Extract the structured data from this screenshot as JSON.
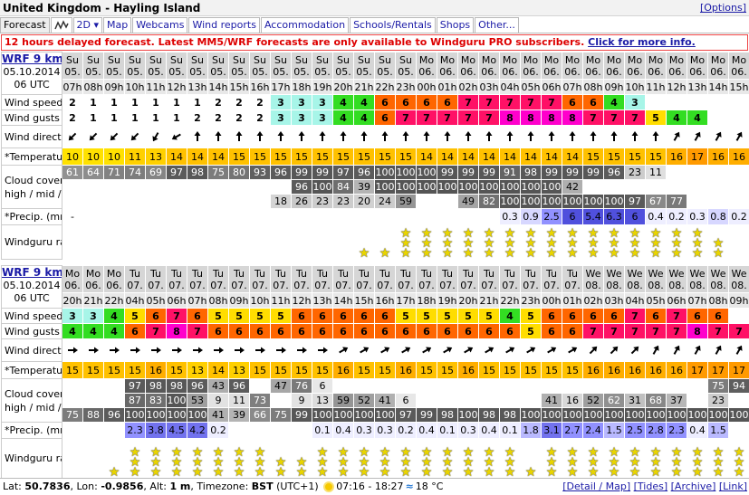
{
  "header": {
    "title": "United Kingdom - Hayling Island",
    "options": "[Options]"
  },
  "tabs": [
    {
      "label": "Forecast",
      "active": true
    },
    {
      "label": "",
      "icon": "chart-icon"
    },
    {
      "label": "2D ▾"
    },
    {
      "label": "Map"
    },
    {
      "label": "Webcams"
    },
    {
      "label": "Wind reports"
    },
    {
      "label": "Accommodation"
    },
    {
      "label": "Schools/Rentals"
    },
    {
      "label": "Shops"
    },
    {
      "label": "Other..."
    }
  ],
  "notice": {
    "text": "12 hours delayed forecast. Latest MM5/WRF forecasts are only available to Windguru PRO subscribers. ",
    "link": "Click for more info."
  },
  "labels": {
    "wind_speed": "Wind speed",
    "wind_gusts": "Wind gusts",
    "unit_bft": "(Bft)",
    "wind_direction": "Wind direction",
    "temperature": "*Temperature",
    "unit_c": "(°C)",
    "cloud1": "Cloud cover (%)",
    "cloud2": "high / mid / low",
    "precip": "*Precip. (mm/1h)",
    "rating": "Windguru rating"
  },
  "colors": {
    "day_header": "#d6d6d6",
    "hour_header": "#e8e8e8",
    "link": "#1a1aa6",
    "notice": "#dd0000"
  },
  "tables": [
    {
      "model": "WRF 9 km",
      "date": "05.10.2014",
      "run": "06 UTC",
      "days": [
        "Su",
        "Su",
        "Su",
        "Su",
        "Su",
        "Su",
        "Su",
        "Su",
        "Su",
        "Su",
        "Su",
        "Su",
        "Su",
        "Su",
        "Su",
        "Su",
        "Su",
        "Mo",
        "Mo",
        "Mo",
        "Mo",
        "Mo",
        "Mo",
        "Mo",
        "Mo",
        "Mo",
        "Mo",
        "Mo",
        "Mo",
        "Mo",
        "Mo",
        "Mo",
        "Mo"
      ],
      "dates": [
        "05.",
        "05.",
        "05.",
        "05.",
        "05.",
        "05.",
        "05.",
        "05.",
        "05.",
        "05.",
        "05.",
        "05.",
        "05.",
        "05.",
        "05.",
        "05.",
        "05.",
        "06.",
        "06.",
        "06.",
        "06.",
        "06.",
        "06.",
        "06.",
        "06.",
        "06.",
        "06.",
        "06.",
        "06.",
        "06.",
        "06.",
        "06.",
        "06."
      ],
      "hours": [
        "07h",
        "08h",
        "09h",
        "10h",
        "11h",
        "12h",
        "13h",
        "14h",
        "15h",
        "16h",
        "17h",
        "18h",
        "19h",
        "20h",
        "21h",
        "22h",
        "23h",
        "00h",
        "01h",
        "02h",
        "03h",
        "04h",
        "05h",
        "06h",
        "07h",
        "08h",
        "09h",
        "10h",
        "11h",
        "12h",
        "13h",
        "14h",
        "15h",
        "16h",
        "17h",
        "18h",
        "19h"
      ],
      "wind_speed": [
        2,
        1,
        1,
        1,
        1,
        1,
        1,
        2,
        2,
        2,
        3,
        3,
        3,
        4,
        4,
        6,
        6,
        6,
        6,
        7,
        7,
        7,
        7,
        7,
        6,
        6,
        4,
        3
      ],
      "wind_gusts": [
        2,
        1,
        1,
        1,
        1,
        1,
        2,
        2,
        2,
        2,
        3,
        3,
        3,
        4,
        4,
        6,
        7,
        7,
        7,
        7,
        7,
        8,
        8,
        8,
        8,
        7,
        7,
        7,
        5,
        4,
        4
      ],
      "direction": [
        225,
        225,
        225,
        225,
        210,
        240,
        0,
        0,
        0,
        0,
        0,
        0,
        0,
        0,
        0,
        0,
        0,
        0,
        0,
        0,
        0,
        0,
        0,
        0,
        0,
        0,
        0,
        0,
        0,
        30,
        30,
        30,
        30
      ],
      "temperature": [
        10,
        10,
        10,
        11,
        13,
        14,
        14,
        14,
        15,
        15,
        15,
        15,
        15,
        15,
        15,
        15,
        15,
        14,
        14,
        14,
        14,
        14,
        14,
        14,
        14,
        15,
        15,
        15,
        15,
        16,
        17,
        16,
        16
      ],
      "cloud_high": [
        61,
        64,
        71,
        74,
        69,
        97,
        98,
        75,
        80,
        93,
        96,
        99,
        99,
        97,
        96,
        100,
        100,
        100,
        99,
        99,
        99,
        91,
        98,
        99,
        99,
        99,
        96,
        23,
        11
      ],
      "cloud_mid": [
        "",
        "",
        "",
        "",
        "",
        "",
        "",
        "",
        "",
        "",
        "",
        "96",
        "100",
        "84",
        "39",
        "100",
        "100",
        "100",
        "100",
        "100",
        "100",
        "100",
        "100",
        "100",
        "42",
        "",
        "",
        "",
        ""
      ],
      "cloud_low": [
        "",
        "",
        "",
        "",
        "",
        "",
        "",
        "",
        "",
        "",
        "18",
        "26",
        "23",
        "23",
        "20",
        "24",
        "59",
        "",
        "",
        "49",
        "82",
        "100",
        "100",
        "100",
        "100",
        "100",
        "100",
        "97",
        "67",
        "77"
      ],
      "precip": [
        "-",
        "",
        "",
        "",
        "",
        "",
        "",
        "",
        "",
        "",
        "",
        "",
        "",
        "",
        "",
        "",
        "",
        "",
        "",
        "",
        "",
        "0.3",
        "0.9",
        "2.5",
        "6",
        "5.4",
        "6.3",
        "6",
        "0.4",
        "0.2",
        "0.3",
        "0.8",
        "0.2"
      ],
      "rating": [
        0,
        0,
        0,
        0,
        0,
        0,
        0,
        0,
        0,
        0,
        0,
        0,
        0,
        0,
        1,
        1,
        3,
        3,
        3,
        3,
        3,
        3,
        3,
        3,
        3,
        3,
        3,
        3,
        3,
        3,
        3,
        2,
        0
      ]
    },
    {
      "model": "WRF 9 km",
      "date": "05.10.2014",
      "run": "06 UTC",
      "days": [
        "Mo",
        "Mo",
        "Mo",
        "Tu",
        "Tu",
        "Tu",
        "Tu",
        "Tu",
        "Tu",
        "Tu",
        "Tu",
        "Tu",
        "Tu",
        "Tu",
        "Tu",
        "Tu",
        "Tu",
        "Tu",
        "Tu",
        "Tu",
        "Tu",
        "Tu",
        "Tu",
        "Tu",
        "Tu",
        "We",
        "We",
        "We",
        "We",
        "We",
        "We",
        "We",
        "We",
        "We",
        "We",
        "We"
      ],
      "dates": [
        "06.",
        "06.",
        "06.",
        "07.",
        "07.",
        "07.",
        "07.",
        "07.",
        "07.",
        "07.",
        "07.",
        "07.",
        "07.",
        "07.",
        "07.",
        "07.",
        "07.",
        "07.",
        "07.",
        "07.",
        "07.",
        "07.",
        "07.",
        "07.",
        "07.",
        "08.",
        "08.",
        "08.",
        "08.",
        "08.",
        "08.",
        "08.",
        "08.",
        "08.",
        "08.",
        "08."
      ],
      "hours": [
        "20h",
        "21h",
        "22h",
        "04h",
        "05h",
        "06h",
        "07h",
        "08h",
        "09h",
        "10h",
        "11h",
        "12h",
        "13h",
        "14h",
        "15h",
        "16h",
        "17h",
        "18h",
        "19h",
        "20h",
        "21h",
        "22h",
        "23h",
        "00h",
        "01h",
        "02h",
        "03h",
        "04h",
        "05h",
        "06h",
        "07h",
        "08h",
        "09h",
        "10h",
        "11h",
        "12h"
      ],
      "wind_speed": [
        3,
        3,
        4,
        5,
        6,
        7,
        6,
        5,
        5,
        5,
        5,
        6,
        6,
        6,
        6,
        6,
        5,
        5,
        5,
        5,
        5,
        4,
        5,
        6,
        6,
        6,
        6,
        7,
        6,
        7,
        6,
        6
      ],
      "wind_gusts": [
        4,
        4,
        4,
        6,
        7,
        8,
        7,
        6,
        6,
        6,
        6,
        6,
        6,
        6,
        6,
        6,
        6,
        6,
        6,
        6,
        6,
        6,
        5,
        6,
        6,
        7,
        7,
        7,
        7,
        7,
        8,
        7,
        7
      ],
      "direction": [
        90,
        90,
        90,
        90,
        90,
        90,
        90,
        90,
        90,
        90,
        90,
        90,
        90,
        60,
        60,
        60,
        60,
        60,
        60,
        60,
        60,
        60,
        60,
        60,
        60,
        45,
        45,
        45,
        30,
        30,
        30,
        30,
        30
      ],
      "temperature": [
        15,
        15,
        15,
        15,
        16,
        15,
        13,
        14,
        13,
        15,
        15,
        15,
        15,
        16,
        15,
        15,
        16,
        15,
        15,
        16,
        15,
        15,
        15,
        15,
        15,
        16,
        16,
        16,
        16,
        16,
        17,
        17,
        17
      ],
      "cloud_high": [
        "",
        "",
        "",
        "97",
        "98",
        "98",
        "96",
        "43",
        "96",
        "",
        "47",
        "76",
        "6",
        "",
        "",
        "",
        "",
        "",
        "",
        "",
        "",
        "",
        "",
        "",
        "",
        "",
        "",
        "",
        "",
        "",
        "",
        "75",
        "94"
      ],
      "cloud_mid": [
        "",
        "",
        "",
        "87",
        "83",
        "100",
        "53",
        "9",
        "11",
        "73",
        "",
        "9",
        "13",
        "59",
        "52",
        "41",
        "6",
        "",
        "",
        "",
        "",
        "",
        "",
        "41",
        "16",
        "52",
        "62",
        "31",
        "68",
        "37",
        "",
        "23",
        ""
      ],
      "cloud_low": [
        "75",
        "88",
        "96",
        "100",
        "100",
        "100",
        "100",
        "41",
        "39",
        "66",
        "75",
        "99",
        "100",
        "100",
        "100",
        "100",
        "97",
        "99",
        "98",
        "100",
        "98",
        "98",
        "100",
        "100",
        "100",
        "100",
        "100",
        "100",
        "100",
        "100",
        "100",
        "100",
        "100"
      ],
      "precip": [
        "",
        "",
        "",
        "2.3",
        "3.8",
        "4.5",
        "4.2",
        "0.2",
        "",
        "",
        "",
        "",
        "0.1",
        "0.4",
        "0.3",
        "0.3",
        "0.2",
        "0.4",
        "0.1",
        "0.3",
        "0.4",
        "0.1",
        "1.8",
        "3.1",
        "2.7",
        "2.4",
        "1.5",
        "2.5",
        "2.8",
        "2.3",
        "0.4",
        "1.5"
      ],
      "rating": [
        0,
        0,
        1,
        3,
        3,
        3,
        3,
        3,
        3,
        3,
        2,
        2,
        3,
        3,
        3,
        3,
        3,
        3,
        3,
        3,
        3,
        3,
        1,
        3,
        3,
        3,
        3,
        3,
        3,
        3,
        3,
        3,
        3
      ]
    }
  ],
  "footer": {
    "lat_label": "Lat: ",
    "lat": "50.7836",
    "lon_label": ", Lon: ",
    "lon": "-0.9856",
    "alt_label": ", Alt: ",
    "alt": "1 m",
    "tz_label": ", Timezone: ",
    "tz": "BST",
    "tz_offset": " (UTC+1) ",
    "sun_times": "07:16 - 18:27",
    "sea_temp": "18 °C",
    "links": [
      "[Detail / Map]",
      "[Tides]",
      "[Archive]",
      "[Link]"
    ]
  }
}
